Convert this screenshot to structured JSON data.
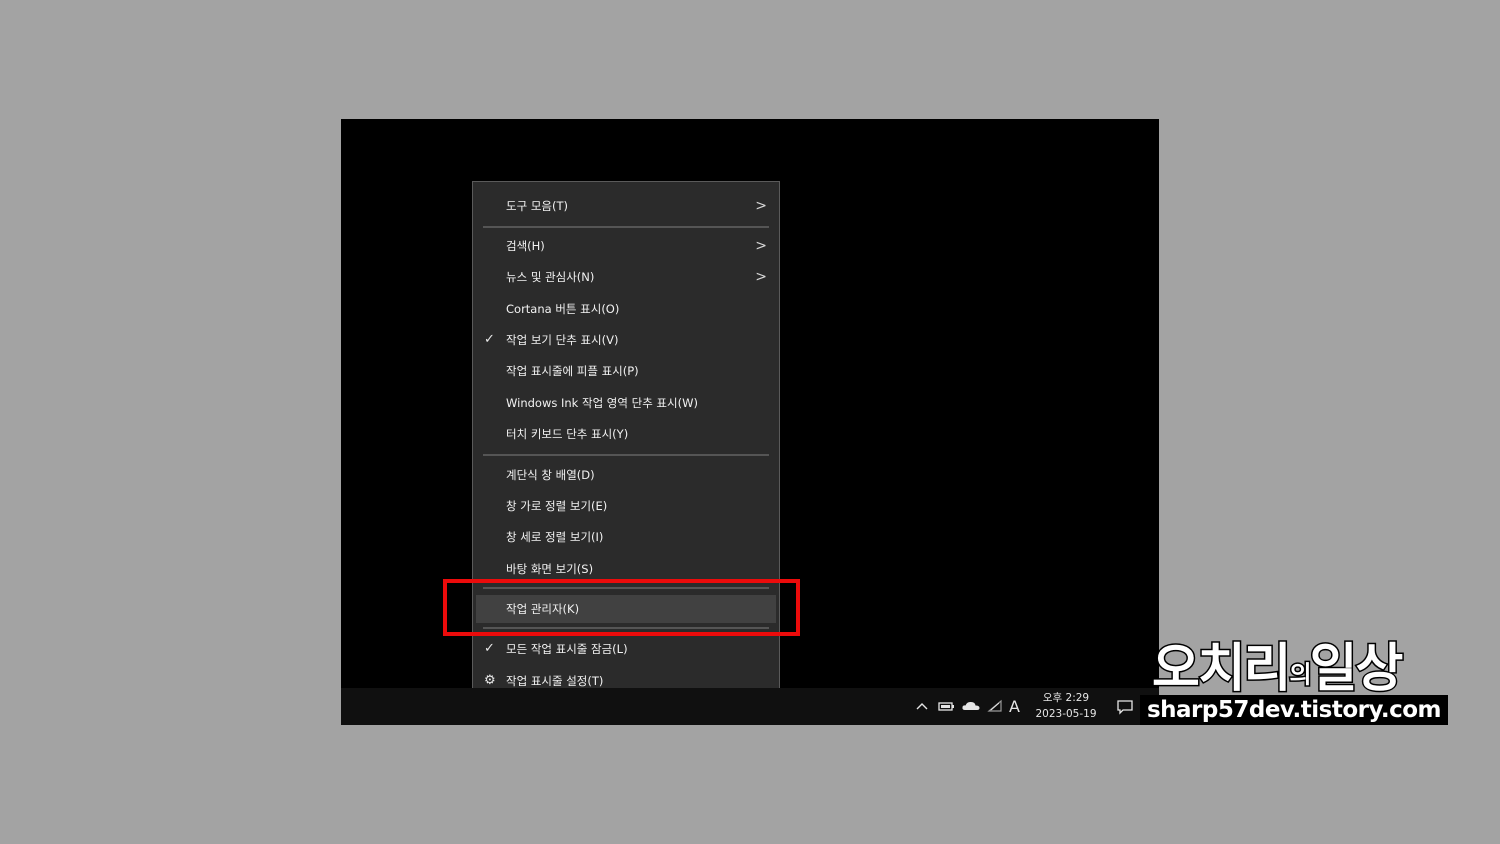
{
  "menu": {
    "items": [
      {
        "label": "도구 모음(T)",
        "submenu": true
      },
      {
        "label": "검색(H)",
        "submenu": true
      },
      {
        "label": "뉴스 및 관심사(N)",
        "submenu": true
      },
      {
        "label": "Cortana 버튼 표시(O)"
      },
      {
        "label": "작업 보기 단추 표시(V)",
        "checked": true
      },
      {
        "label": "작업 표시줄에 피플 표시(P)"
      },
      {
        "label": "Windows Ink 작업 영역 단추 표시(W)"
      },
      {
        "label": "터치 키보드 단추 표시(Y)"
      },
      {
        "label": "계단식 창 배열(D)"
      },
      {
        "label": "창 가로 정렬 보기(E)"
      },
      {
        "label": "창 세로 정렬 보기(I)"
      },
      {
        "label": "바탕 화면 보기(S)"
      },
      {
        "label": "작업 관리자(K)",
        "highlighted": true
      },
      {
        "label": "모든 작업 표시줄 잠금(L)",
        "checked": true
      },
      {
        "label": "작업 표시줄 설정(T)",
        "icon": "gear-icon"
      }
    ],
    "arrow_glyph": ">",
    "check_glyph": "✓",
    "gear_glyph": "⚙"
  },
  "taskbar": {
    "tray_icons": [
      "chevron-up-icon",
      "battery-icon",
      "onedrive-cloud-icon",
      "network-icon"
    ],
    "ime_indicator": "A",
    "clock_time": "오후 2:29",
    "clock_date": "2023-05-19",
    "notification_icon": "action-center-icon"
  },
  "watermark": {
    "title_main": "오치리",
    "title_small": "의",
    "title_end": "일상",
    "url": "sharp57dev.tistory.com"
  },
  "colors": {
    "highlight_border": "#ec0b0b",
    "menu_bg": "#2b2b2b",
    "page_bg": "#a3a3a3"
  }
}
